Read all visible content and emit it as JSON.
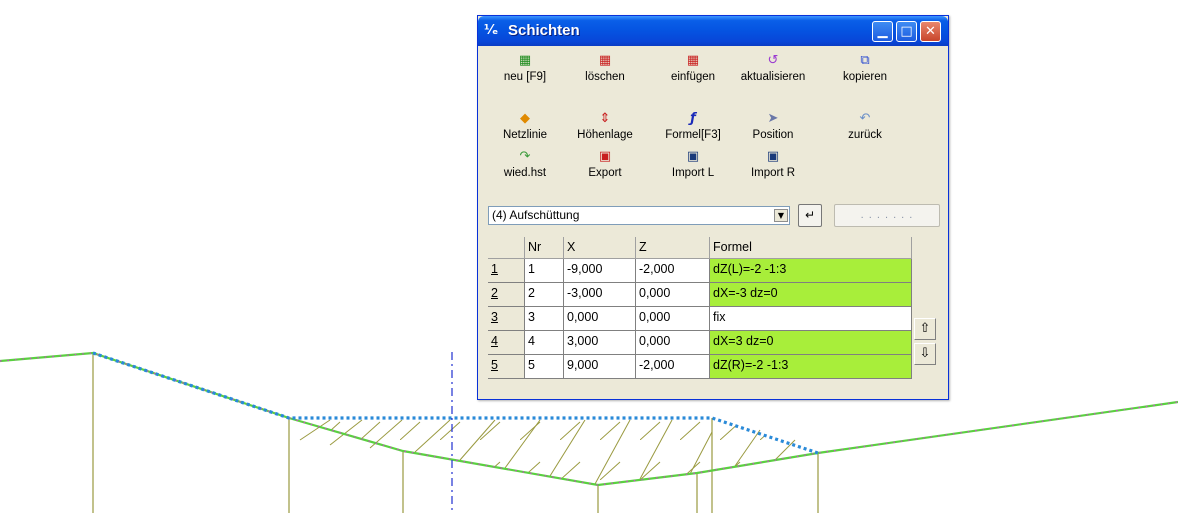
{
  "window": {
    "title": "Schichten",
    "title_icon": "layers-app-icon",
    "controls": [
      "minimize",
      "maximize",
      "close"
    ]
  },
  "toolbar": {
    "buttons": [
      {
        "label": "neu [F9]",
        "icon": "new-layer-icon",
        "color": "#1a8a1a"
      },
      {
        "label": "löschen",
        "icon": "delete-layer-icon",
        "color": "#c81e1e"
      },
      {
        "label": "einfügen",
        "icon": "insert-layer-icon",
        "color": "#c81e1e"
      },
      {
        "label": "aktualisieren",
        "icon": "refresh-icon",
        "color": "#9a3ad0"
      },
      {
        "label": "kopieren",
        "icon": "copy-icon",
        "color": "#2a4bd0"
      },
      {
        "label": "Netzlinie",
        "icon": "netline-icon",
        "color": "#e08a00"
      },
      {
        "label": "Höhenlage",
        "icon": "elevation-icon",
        "color": "#c81e1e"
      },
      {
        "label": "Formel[F3]",
        "icon": "formula-icon",
        "color": "#1a2ab8"
      },
      {
        "label": "Position",
        "icon": "position-icon",
        "color": "#6a78a8"
      },
      {
        "label": "zurück",
        "icon": "undo-icon",
        "color": "#6a8fc8"
      },
      {
        "label": "wied.hst",
        "icon": "redo-icon",
        "color": "#3a9a3a"
      },
      {
        "label": "Export",
        "icon": "export-icon",
        "color": "#c81e1e"
      },
      {
        "label": "Import L",
        "icon": "import-left-icon",
        "color": "#1a3a7a"
      },
      {
        "label": "Import R",
        "icon": "import-right-icon",
        "color": "#1a3a7a"
      }
    ]
  },
  "layer_select": {
    "value": "(4) Aufschüttung"
  },
  "apply_button": {
    "icon": "apply-arrow-icon"
  },
  "dots_button": {
    "label": ". . . . . . ."
  },
  "table": {
    "headers": [
      "Nr",
      "X",
      "Z",
      "Formel"
    ],
    "rows": [
      {
        "row": "1",
        "nr": "1",
        "x": "-9,000",
        "z": "-2,000",
        "formel": "dZ(L)=-2 -1:3",
        "highlight": true
      },
      {
        "row": "2",
        "nr": "2",
        "x": "-3,000",
        "z": "0,000",
        "formel": "dX=-3 dz=0",
        "highlight": true
      },
      {
        "row": "3",
        "nr": "3",
        "x": "0,000",
        "z": "0,000",
        "formel": "fix",
        "highlight": false
      },
      {
        "row": "4",
        "nr": "4",
        "x": "3,000",
        "z": "0,000",
        "formel": "dX=3 dz=0",
        "highlight": true
      },
      {
        "row": "5",
        "nr": "5",
        "x": "9,000",
        "z": "-2,000",
        "formel": "dZ(R)=-2 -1:3",
        "highlight": true
      }
    ],
    "highlight_color": "#a8ee3a",
    "move_up_icon": "arrow-up-icon",
    "move_down_icon": "arrow-down-icon"
  },
  "drawing": {
    "terrain_color": "#5ad040",
    "terrain_dot_color": "#d040d0",
    "fill_layer_color": "#2a8ad8",
    "hatch_color": "#9a9a40",
    "post_color": "#9a9a40",
    "axis_color": "#2030d0"
  }
}
